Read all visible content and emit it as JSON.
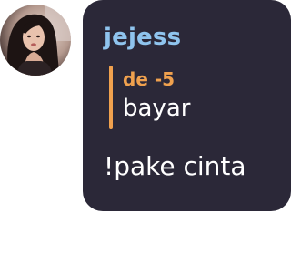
{
  "avatar": {
    "icon": "user-avatar-photo"
  },
  "message": {
    "username": "jejess",
    "username_color": "#8fc4ee",
    "reply": {
      "author": "de -5",
      "author_color": "#f0a14e",
      "bar_color": "#f0a14e",
      "text": "bayar"
    },
    "text": "!pake cinta",
    "bubble_color": "#2b2838"
  }
}
